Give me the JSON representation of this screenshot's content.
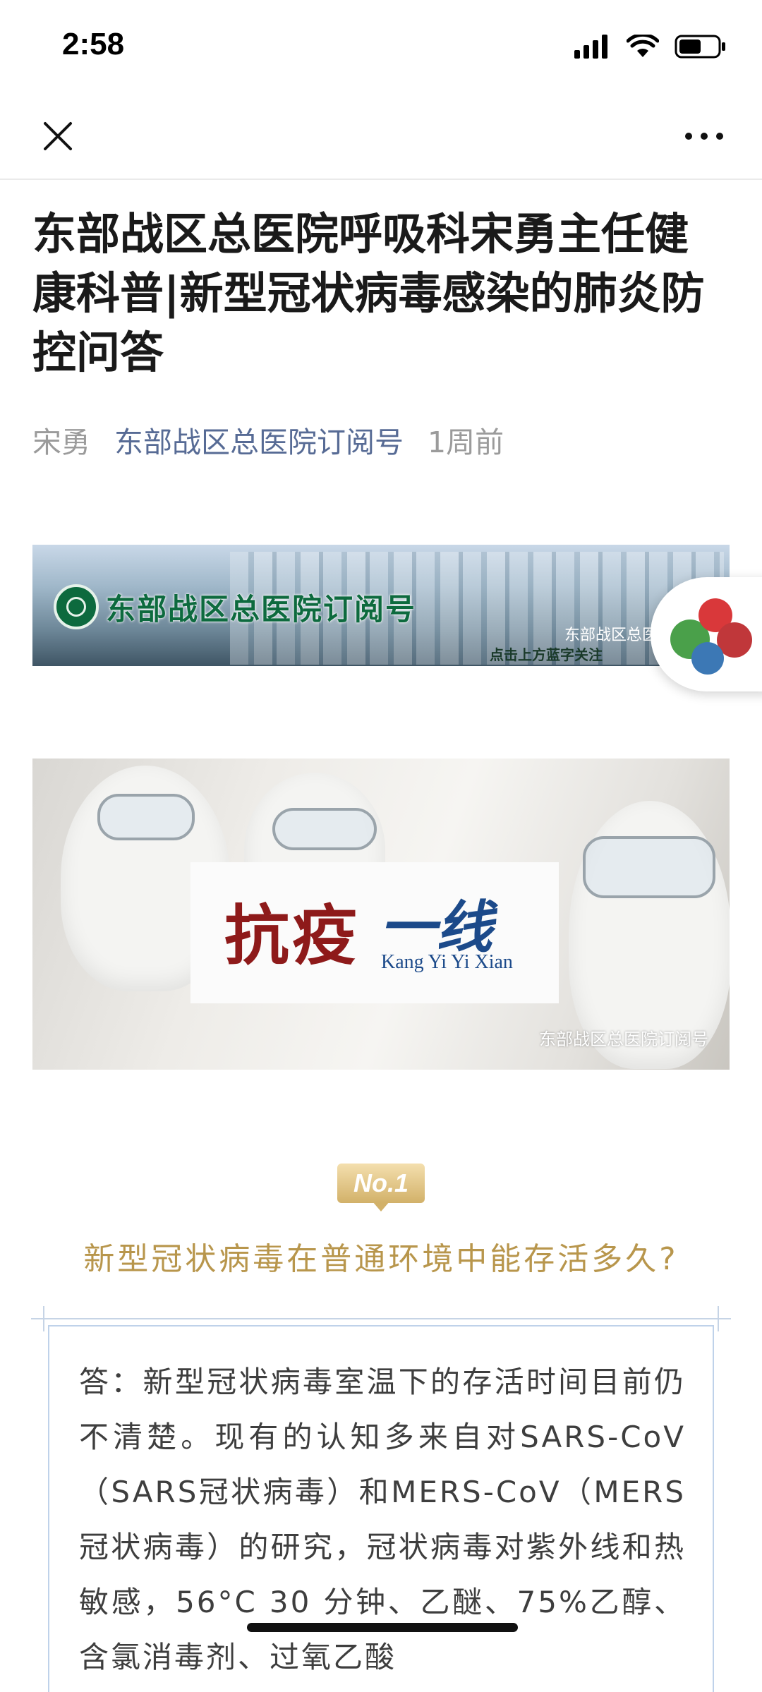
{
  "status_bar": {
    "time": "2:58",
    "signal_icon": "cellular-signal-icon",
    "wifi_icon": "wifi-icon",
    "battery_icon": "battery-icon"
  },
  "navbar": {
    "close_icon": "close-icon",
    "more_icon": "more-horizontal-icon"
  },
  "article": {
    "title": "东部战区总医院呼吸科宋勇主任健康科普|新型冠状病毒感染的肺炎防控问答",
    "author": "宋勇",
    "account": "东部战区总医院订阅号",
    "time_ago": "1周前"
  },
  "banner": {
    "name": "东部战区总医院订阅号",
    "watermark": "东部战区总医院",
    "follow_hint": "点击上方蓝字关注"
  },
  "photo": {
    "title_cn_1": "抗疫",
    "title_cn_2": "一线",
    "pinyin": "Kang Yi Yi Xian",
    "watermark": "东部战区总医院订阅号"
  },
  "section": {
    "badge": "No.1",
    "question": "新型冠状病毒在普通环境中能存活多久?",
    "answer": "答：新型冠状病毒室温下的存活时间目前仍不清楚。现有的认知多来自对SARS-CoV（SARS冠状病毒）和MERS-CoV（MERS冠状病毒）的研究，冠状病毒对紫外线和热敏感，56°C 30 分钟、乙醚、75%乙醇、含氯消毒剂、过氧乙酸"
  },
  "colors": {
    "link": "#576b95",
    "gold": "#b8964c",
    "frame": "#c6d4e6"
  }
}
